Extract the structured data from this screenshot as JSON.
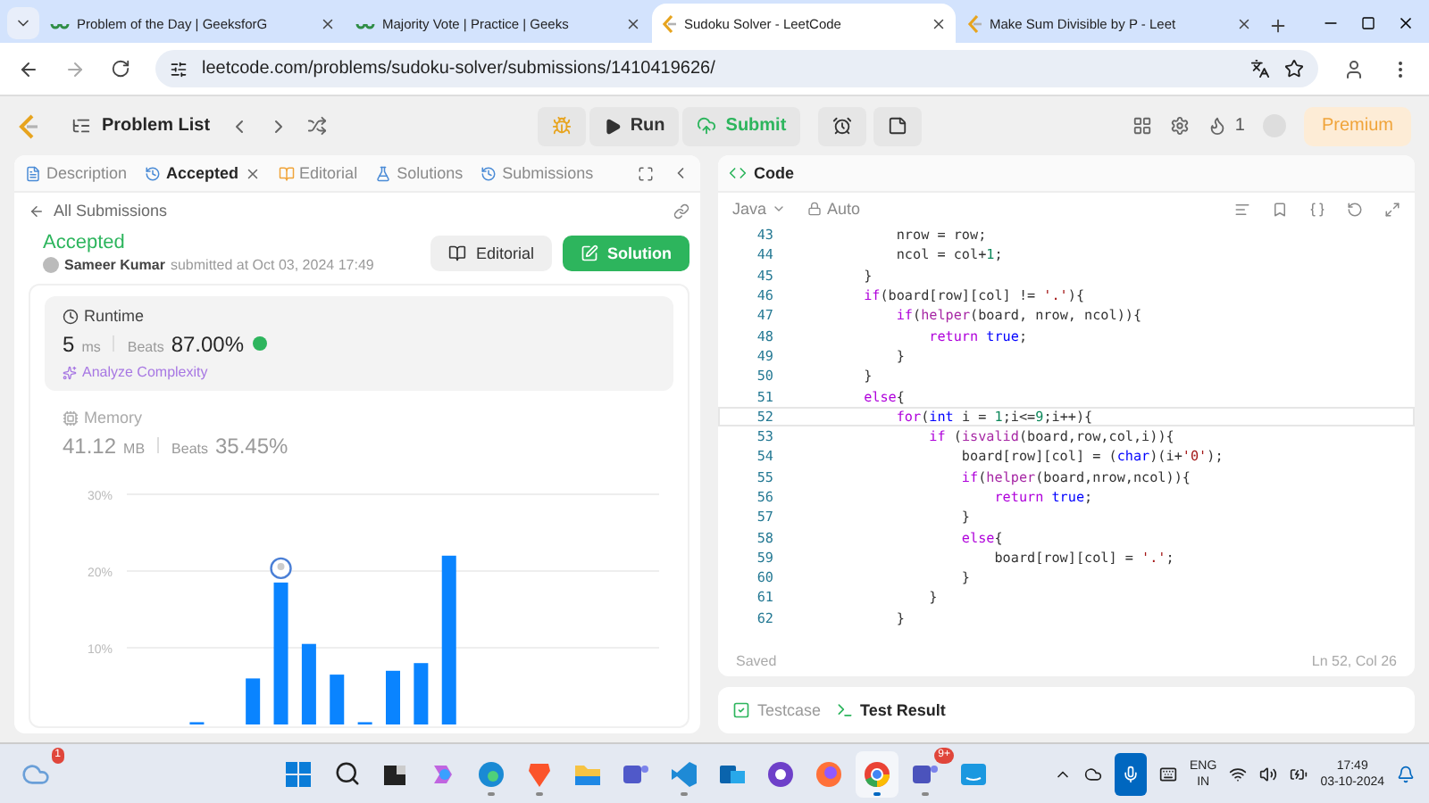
{
  "browser": {
    "tabs": [
      {
        "title": "Problem of the Day | GeeksforG",
        "kind": "gfg",
        "selected": false
      },
      {
        "title": "Majority Vote | Practice | Geeks",
        "kind": "gfg",
        "selected": false
      },
      {
        "title": "Sudoku Solver - LeetCode",
        "kind": "leetcode",
        "selected": true
      },
      {
        "title": "Make Sum Divisible by P - Leet",
        "kind": "leetcode",
        "selected": false
      }
    ],
    "url": "leetcode.com/problems/sudoku-solver/submissions/1410419626/"
  },
  "toolbar": {
    "problem_list": "Problem List",
    "run": "Run",
    "submit": "Submit",
    "streak": "1",
    "premium": "Premium"
  },
  "left_panel": {
    "tabs": [
      {
        "label": "Description",
        "kind": "doc",
        "selected": false,
        "closable": false
      },
      {
        "label": "Accepted",
        "kind": "history",
        "selected": true,
        "closable": true
      },
      {
        "label": "Editorial",
        "kind": "book",
        "selected": false,
        "closable": false
      },
      {
        "label": "Solutions",
        "kind": "flask",
        "selected": false,
        "closable": false
      },
      {
        "label": "Submissions",
        "kind": "history",
        "selected": false,
        "closable": false
      }
    ],
    "back_link": "All Submissions",
    "status": "Accepted",
    "author": "Sameer Kumar",
    "submitted": "submitted at Oct 03, 2024 17:49",
    "editorial_button": "Editorial",
    "solution_button": "Solution",
    "stats": [
      {
        "kind": "runtime",
        "title": "Runtime",
        "value": "5",
        "unit": "ms",
        "beats_label": "Beats",
        "beats": "87.00%",
        "analyze": "Analyze Complexity",
        "selected": true
      },
      {
        "kind": "memory",
        "title": "Memory",
        "value": "41.12",
        "unit": "MB",
        "beats_label": "Beats",
        "beats": "35.45%",
        "selected": false
      }
    ],
    "chart_data": {
      "type": "bar",
      "values": [
        null,
        null,
        0.3,
        null,
        6,
        18.5,
        10.5,
        6.5,
        0.3,
        7,
        8,
        22,
        null,
        null,
        null,
        null,
        null,
        null,
        null
      ],
      "ylim": [
        0,
        30
      ],
      "yticks": [
        {
          "value": 10,
          "label": "10%"
        },
        {
          "value": 20,
          "label": "20%"
        },
        {
          "value": 30,
          "label": "30%"
        }
      ]
    }
  },
  "right_panel": {
    "title": "Code",
    "language": "Java",
    "mode": "Auto",
    "lines": [
      {
        "number": "43",
        "active": false,
        "tokens": [
          {
            "text": "            nrow = row;",
            "kind": "plain"
          }
        ]
      },
      {
        "number": "44",
        "active": false,
        "tokens": [
          {
            "text": "            ncol = col+",
            "kind": "plain"
          },
          {
            "text": "1",
            "kind": "number"
          },
          {
            "text": ";",
            "kind": "plain"
          }
        ]
      },
      {
        "number": "45",
        "active": false,
        "tokens": [
          {
            "text": "        }",
            "kind": "plain"
          }
        ]
      },
      {
        "number": "46",
        "active": false,
        "tokens": [
          {
            "text": "        if",
            "kind": "keyword"
          },
          {
            "text": "(board[row][col] != ",
            "kind": "plain"
          },
          {
            "text": "'.'",
            "kind": "string"
          },
          {
            "text": "){",
            "kind": "plain"
          }
        ]
      },
      {
        "number": "47",
        "active": false,
        "tokens": [
          {
            "text": "            if",
            "kind": "keyword"
          },
          {
            "text": "(",
            "kind": "plain"
          },
          {
            "text": "helper",
            "kind": "function"
          },
          {
            "text": "(board, nrow, ncol)){",
            "kind": "plain"
          }
        ]
      },
      {
        "number": "48",
        "active": false,
        "tokens": [
          {
            "text": "                return",
            "kind": "keyword"
          },
          {
            "text": " true",
            "kind": "type"
          },
          {
            "text": ";",
            "kind": "plain"
          }
        ]
      },
      {
        "number": "49",
        "active": false,
        "tokens": [
          {
            "text": "            }",
            "kind": "plain"
          }
        ]
      },
      {
        "number": "50",
        "active": false,
        "tokens": [
          {
            "text": "        }",
            "kind": "plain"
          }
        ]
      },
      {
        "number": "51",
        "active": false,
        "tokens": [
          {
            "text": "        else",
            "kind": "keyword"
          },
          {
            "text": "{",
            "kind": "plain"
          }
        ]
      },
      {
        "number": "52",
        "active": true,
        "tokens": [
          {
            "text": "            for",
            "kind": "keyword"
          },
          {
            "text": "(",
            "kind": "plain"
          },
          {
            "text": "int",
            "kind": "type"
          },
          {
            "text": " i = ",
            "kind": "plain"
          },
          {
            "text": "1",
            "kind": "number"
          },
          {
            "text": ";i<=",
            "kind": "plain"
          },
          {
            "text": "9",
            "kind": "number"
          },
          {
            "text": ";i++){",
            "kind": "plain"
          }
        ]
      },
      {
        "number": "53",
        "active": false,
        "tokens": [
          {
            "text": "                if",
            "kind": "keyword"
          },
          {
            "text": " (",
            "kind": "plain"
          },
          {
            "text": "isvalid",
            "kind": "function"
          },
          {
            "text": "(board,row,col,i)){",
            "kind": "plain"
          }
        ]
      },
      {
        "number": "54",
        "active": false,
        "tokens": [
          {
            "text": "                    board[row][col] = (",
            "kind": "plain"
          },
          {
            "text": "char",
            "kind": "type"
          },
          {
            "text": ")(i+",
            "kind": "plain"
          },
          {
            "text": "'0'",
            "kind": "string"
          },
          {
            "text": ");",
            "kind": "plain"
          }
        ]
      },
      {
        "number": "55",
        "active": false,
        "tokens": [
          {
            "text": "                    if",
            "kind": "keyword"
          },
          {
            "text": "(",
            "kind": "plain"
          },
          {
            "text": "helper",
            "kind": "function"
          },
          {
            "text": "(board,nrow,ncol)){",
            "kind": "plain"
          }
        ]
      },
      {
        "number": "56",
        "active": false,
        "tokens": [
          {
            "text": "                        return",
            "kind": "keyword"
          },
          {
            "text": " true",
            "kind": "type"
          },
          {
            "text": ";",
            "kind": "plain"
          }
        ]
      },
      {
        "number": "57",
        "active": false,
        "tokens": [
          {
            "text": "                    }",
            "kind": "plain"
          }
        ]
      },
      {
        "number": "58",
        "active": false,
        "tokens": [
          {
            "text": "                    else",
            "kind": "keyword"
          },
          {
            "text": "{",
            "kind": "plain"
          }
        ]
      },
      {
        "number": "59",
        "active": false,
        "tokens": [
          {
            "text": "                        board[row][col] = ",
            "kind": "plain"
          },
          {
            "text": "'.'",
            "kind": "string"
          },
          {
            "text": ";",
            "kind": "plain"
          }
        ]
      },
      {
        "number": "60",
        "active": false,
        "tokens": [
          {
            "text": "                    }",
            "kind": "plain"
          }
        ]
      },
      {
        "number": "61",
        "active": false,
        "tokens": [
          {
            "text": "                }",
            "kind": "plain"
          }
        ]
      },
      {
        "number": "62",
        "active": false,
        "tokens": [
          {
            "text": "            }",
            "kind": "plain"
          }
        ]
      }
    ],
    "status": "Saved",
    "cursor": "Ln 52, Col 26",
    "bottom_tabs": [
      {
        "label": "Testcase",
        "kind": "check",
        "selected": false
      },
      {
        "label": "Test Result",
        "kind": "terminal",
        "selected": true
      }
    ]
  },
  "taskbar": {
    "weather_badge": "1",
    "apps": [
      {
        "kind": "windows",
        "running": false,
        "selected": false
      },
      {
        "kind": "search",
        "running": false,
        "selected": false
      },
      {
        "kind": "taskview",
        "running": false,
        "selected": false
      },
      {
        "kind": "copilot",
        "running": false,
        "selected": false
      },
      {
        "kind": "edge",
        "running": true,
        "selected": false
      },
      {
        "kind": "brave",
        "running": true,
        "selected": false
      },
      {
        "kind": "folder",
        "running": false,
        "selected": false
      },
      {
        "kind": "teams",
        "running": false,
        "selected": false
      },
      {
        "kind": "vscode",
        "running": true,
        "selected": false
      },
      {
        "kind": "outlook",
        "running": false,
        "selected": false
      },
      {
        "kind": "github",
        "running": false,
        "selected": false
      },
      {
        "kind": "firefox",
        "running": false,
        "selected": false
      },
      {
        "kind": "chrome",
        "running": true,
        "selected": true
      },
      {
        "kind": "teams-work",
        "running": true,
        "selected": false,
        "badge": "9+"
      },
      {
        "kind": "prime",
        "running": false,
        "selected": false
      }
    ],
    "lang": "ENG",
    "region": "IN",
    "time": "17:49",
    "date": "03-10-2024"
  }
}
